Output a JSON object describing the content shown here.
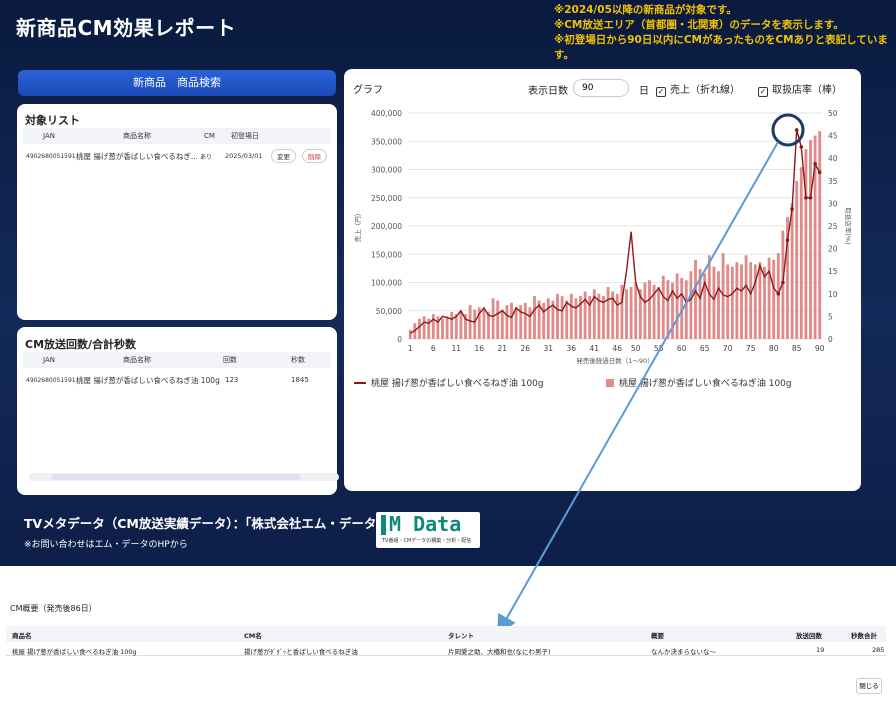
{
  "header": {
    "title": "新商品CM効果レポート",
    "notes": [
      "※2024/05以降の新商品が対象です。",
      "※CM放送エリア（首都圏・北関東）のデータを表示します。",
      "※初登場日から90日以内にCMがあったものをCMありと表記しています。"
    ]
  },
  "search": {
    "label": "新商品　商品検索"
  },
  "target_list": {
    "title": "対象リスト",
    "columns": [
      "JAN",
      "商品名称",
      "CM",
      "初登場日"
    ],
    "rows": [
      {
        "jan": "4902680051591",
        "name": "桃屋 揚げ葱が香ばしい食べるねぎ...",
        "cm": "あり",
        "date": "2025/03/01",
        "change": "変更",
        "delete": "削除"
      }
    ]
  },
  "cm_count": {
    "title": "CM放送回数/合計秒数",
    "columns": [
      "JAN",
      "商品名称",
      "回数",
      "秒数"
    ],
    "rows": [
      {
        "jan": "4902680051591",
        "name": "桃屋 揚げ葱が香ばしい食べるねぎ油 100g",
        "count": "123",
        "seconds": "1845"
      }
    ]
  },
  "graph_panel": {
    "title": "グラフ",
    "days_label": "表示日数",
    "days_value": "90",
    "days_unit": "日",
    "sales_checkbox": "売上（折れ線）",
    "stores_checkbox": "取扱店率（棒）"
  },
  "chart_data": {
    "type": "bar",
    "xlabel": "発売後経過日数（1〜90）",
    "ylabel": "売上（円）",
    "y2label": "取扱店率(%)",
    "ylim": [
      0,
      400000
    ],
    "y2lim": [
      0,
      50
    ],
    "yticks": [
      "0",
      "50,000",
      "100,000",
      "150,000",
      "200,000",
      "250,000",
      "300,000",
      "350,000",
      "400,000"
    ],
    "y2ticks": [
      "0",
      "5",
      "10",
      "15",
      "20",
      "25",
      "30",
      "35",
      "40",
      "45",
      "50"
    ],
    "xticks": [
      "1",
      "6",
      "11",
      "16",
      "21",
      "26",
      "31",
      "36",
      "41",
      "46",
      "50",
      "55",
      "60",
      "65",
      "70",
      "75",
      "80",
      "85",
      "90"
    ],
    "grid": true,
    "legend_position": "bottom",
    "series": [
      {
        "name": "桃屋 揚げ葱が香ばしい食べるねぎ油 100g",
        "kind": "line",
        "axis": "left",
        "color": "#8b1a1a",
        "values": [
          10000,
          15000,
          22000,
          30000,
          28000,
          35000,
          30000,
          40000,
          38000,
          35000,
          40000,
          50000,
          35000,
          32000,
          30000,
          45000,
          55000,
          42000,
          40000,
          45000,
          50000,
          42000,
          38000,
          55000,
          48000,
          45000,
          40000,
          52000,
          60000,
          48000,
          55000,
          60000,
          52000,
          50000,
          65000,
          58000,
          55000,
          62000,
          70000,
          60000,
          75000,
          68000,
          65000,
          70000,
          72000,
          60000,
          65000,
          120000,
          190000,
          100000,
          75000,
          65000,
          70000,
          80000,
          90000,
          75000,
          68000,
          85000,
          72000,
          80000,
          65000,
          70000,
          85000,
          72000,
          100000,
          80000,
          70000,
          90000,
          78000,
          75000,
          80000,
          90000,
          85000,
          95000,
          80000,
          100000,
          130000,
          110000,
          120000,
          90000,
          80000,
          100000,
          175000,
          230000,
          370000,
          340000,
          250000,
          250000,
          310000,
          295000
        ]
      },
      {
        "name": "桃屋 揚げ葱が香ばしい食べるねぎ油 100g",
        "kind": "bar",
        "axis": "right",
        "color": "#e08a8a",
        "values": [
          2.0,
          3.5,
          4.5,
          5.0,
          4.5,
          5.5,
          5.0,
          4.5,
          5.0,
          6.0,
          5.5,
          6.0,
          5.5,
          7.5,
          6.5,
          7.0,
          6.5,
          6.0,
          9.0,
          8.5,
          6.5,
          7.5,
          8.0,
          7.0,
          7.5,
          8.0,
          7.0,
          9.5,
          8.5,
          8.0,
          9.0,
          8.5,
          10.0,
          9.5,
          8.5,
          10.0,
          9.0,
          9.5,
          10.5,
          9.5,
          11.0,
          10.0,
          9.5,
          11.5,
          10.5,
          10.0,
          12.0,
          11.0,
          11.5,
          12.5,
          11.0,
          12.5,
          13.0,
          12.0,
          11.5,
          14.0,
          13.0,
          12.5,
          14.5,
          13.5,
          13.0,
          15.0,
          17.5,
          15.5,
          14.5,
          18.5,
          16.0,
          15.0,
          19.0,
          16.5,
          16.0,
          17.0,
          16.5,
          18.5,
          17.0,
          16.5,
          17.0,
          16.0,
          18.0,
          17.5,
          19.0,
          24.0,
          27.0,
          30.0,
          35.0,
          38.0,
          42.0,
          44.0,
          45.0,
          46.0
        ]
      }
    ],
    "highlight_day": 86
  },
  "footer": {
    "main": "TVメタデータ（CM放送実績データ）：「株式会社エム・データ」提供",
    "sub": "※お問い合わせはエム・データのHPから",
    "logo_text": "M Data",
    "logo_caption": "TV番組・CMデータの構築・分析・配信"
  },
  "summary": {
    "title": "CM概要（発売後86日）",
    "columns": [
      "商品名",
      "CM名",
      "タレント",
      "概要",
      "放送回数",
      "秒数合計"
    ],
    "row": [
      "桃屋 揚げ葱が香ばしい食べるねぎ油 100g",
      "揚げ葱がﾀﾞﾀﾞｯと香ばしい食べるねぎ油",
      "片岡愛之助、大橋和也(なにわ男子)",
      "なんか決まらないな〜",
      "19",
      "285"
    ],
    "close": "閉じる"
  }
}
